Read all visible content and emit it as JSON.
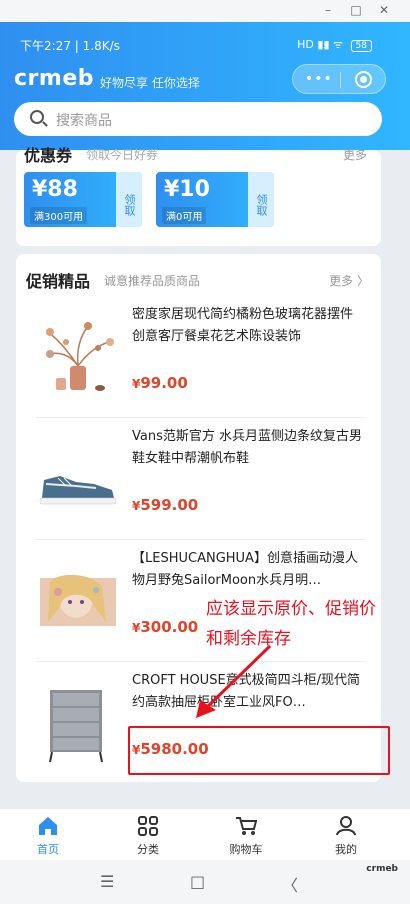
{
  "window": {
    "minimize": "–",
    "maximize": "□",
    "close": "✕"
  },
  "status": {
    "time_speed": "下午2:27 | 1.8K/s",
    "signal": "HD ▮▮ ᯤ",
    "battery": "58"
  },
  "header": {
    "logo": "crmeb",
    "slogan": "好物尽享 任你选择",
    "capsule_dots": "•••"
  },
  "search": {
    "placeholder": "搜索商品"
  },
  "coupons": {
    "title": "优惠券",
    "subtitle": "领取今日好券",
    "more": "更多",
    "items": [
      {
        "amount": "¥88",
        "condition": "满300可用",
        "action": "领取"
      },
      {
        "amount": "¥10",
        "condition": "满0可用",
        "action": "领取"
      }
    ]
  },
  "promo": {
    "title": "促销精品",
    "subtitle": "诚意推荐品质商品",
    "more": "更多 〉",
    "items": [
      {
        "title": "密度家居现代简约橘粉色玻璃花器摆件创意客厅餐桌花艺术陈设装饰",
        "currency": "¥",
        "price": "99.00"
      },
      {
        "title": "Vans范斯官方 水兵月蓝侧边条纹复古男鞋女鞋中帮潮帆布鞋",
        "currency": "¥",
        "price": "599.00"
      },
      {
        "title": "【LESHUCANGHUA】创意插画动漫人物月野兔SailorMoon水兵月明…",
        "currency": "¥",
        "price": "300.00"
      },
      {
        "title": "CROFT HOUSE意式极简四斗柜/现代简约高款抽屉柜卧室工业风FO…",
        "currency": "¥",
        "price": "5980.00"
      }
    ]
  },
  "annotation": {
    "text": "应该显示原价、促销价和剩余库存"
  },
  "tabbar": {
    "tabs": [
      {
        "label": "首页"
      },
      {
        "label": "分类"
      },
      {
        "label": "购物车"
      },
      {
        "label": "我的"
      }
    ]
  },
  "navbar": {
    "menu": "☰",
    "home": "□",
    "back": "〈",
    "watermark": "crmeb"
  },
  "colors": {
    "primary": "#2f8ff0",
    "price": "#e0452b",
    "annotation": "#e8111d"
  }
}
